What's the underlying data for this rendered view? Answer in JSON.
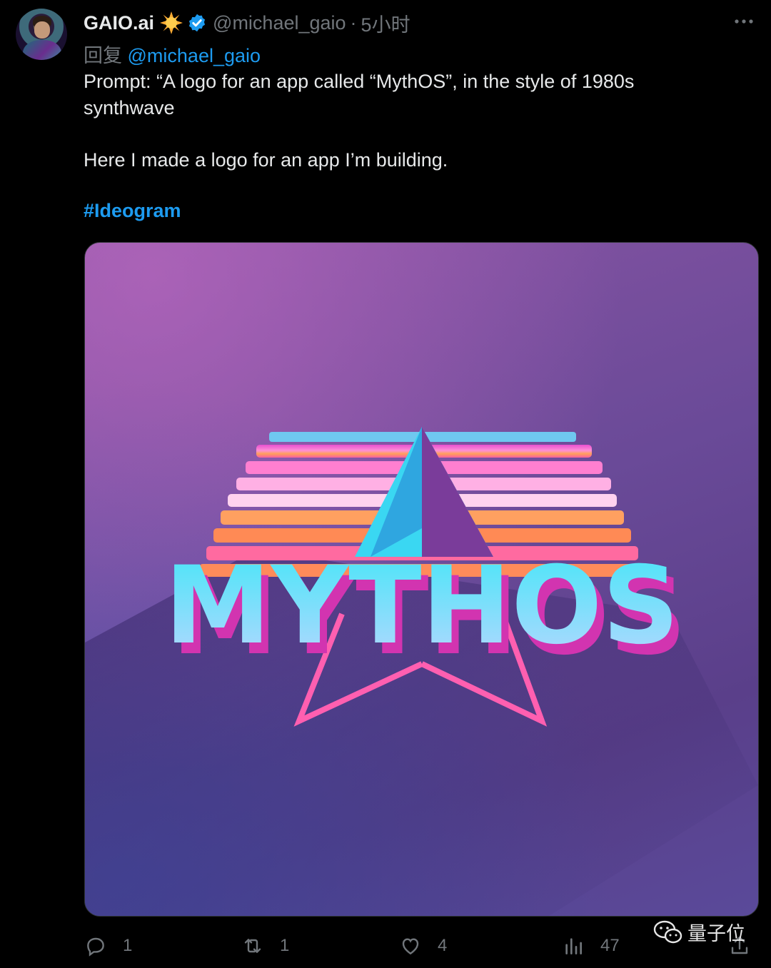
{
  "tweet": {
    "author_name": "GAIO.ai",
    "author_emoji": "sun-emoji",
    "handle": "@michael_gaio",
    "separator": "·",
    "time": "5小时",
    "reply_prefix": "回复",
    "reply_to": "@michael_gaio",
    "text_line1": "Prompt: “A logo for an app called “MythOS”, in the style of 1980s synthwave",
    "text_line2": "Here I made a logo for an app I’m building.",
    "hashtag": "#Ideogram",
    "image_text": "MYTHOS"
  },
  "actions": {
    "reply_count": "1",
    "retweet_count": "1",
    "like_count": "4",
    "views_count": "47"
  },
  "watermark": {
    "text": "量子位"
  },
  "colors": {
    "background": "#000000",
    "text_primary": "#e7e9ea",
    "text_secondary": "#71767b",
    "link": "#1d9bf0",
    "verified": "#1d9bf0"
  }
}
